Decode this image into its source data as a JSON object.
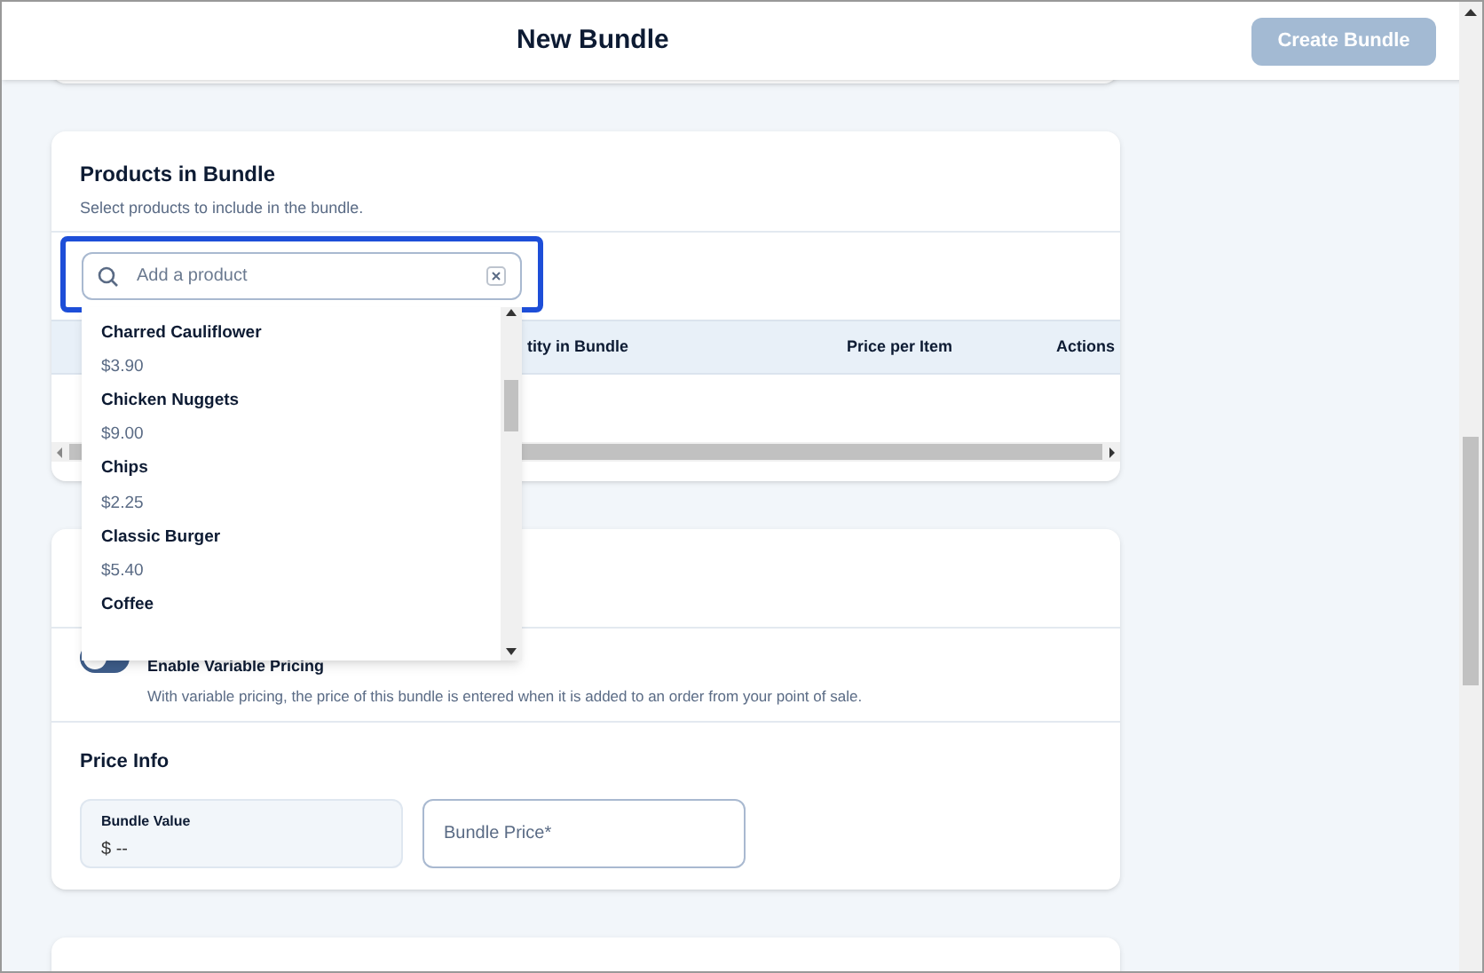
{
  "header": {
    "title": "New Bundle",
    "create_button": {
      "label": "Create Bundle",
      "disabled": true
    }
  },
  "products_card": {
    "title": "Products in Bundle",
    "subtitle": "Select products to include in the bundle.",
    "search": {
      "placeholder": "Add a product",
      "focused": true
    },
    "columns": [
      "tity in Bundle",
      "Price per Item",
      "Actions"
    ],
    "dropdown": [
      {
        "name": "Charred Cauliflower",
        "price": "$3.90"
      },
      {
        "name": "Chicken Nuggets",
        "price": "$9.00"
      },
      {
        "name": "Chips",
        "price": "$2.25"
      },
      {
        "name": "Classic Burger",
        "price": "$5.40"
      },
      {
        "name": "Coffee"
      }
    ]
  },
  "pricing_card": {
    "variable_pricing": {
      "label": "Enable Variable Pricing",
      "description": "With variable pricing, the price of this bundle is entered when it is added to an order from your point of sale.",
      "on": false
    },
    "price_info_title": "Price Info",
    "bundle_value": {
      "label": "Bundle Value",
      "value": "$ --"
    },
    "bundle_price": {
      "placeholder": "Bundle Price*"
    }
  }
}
